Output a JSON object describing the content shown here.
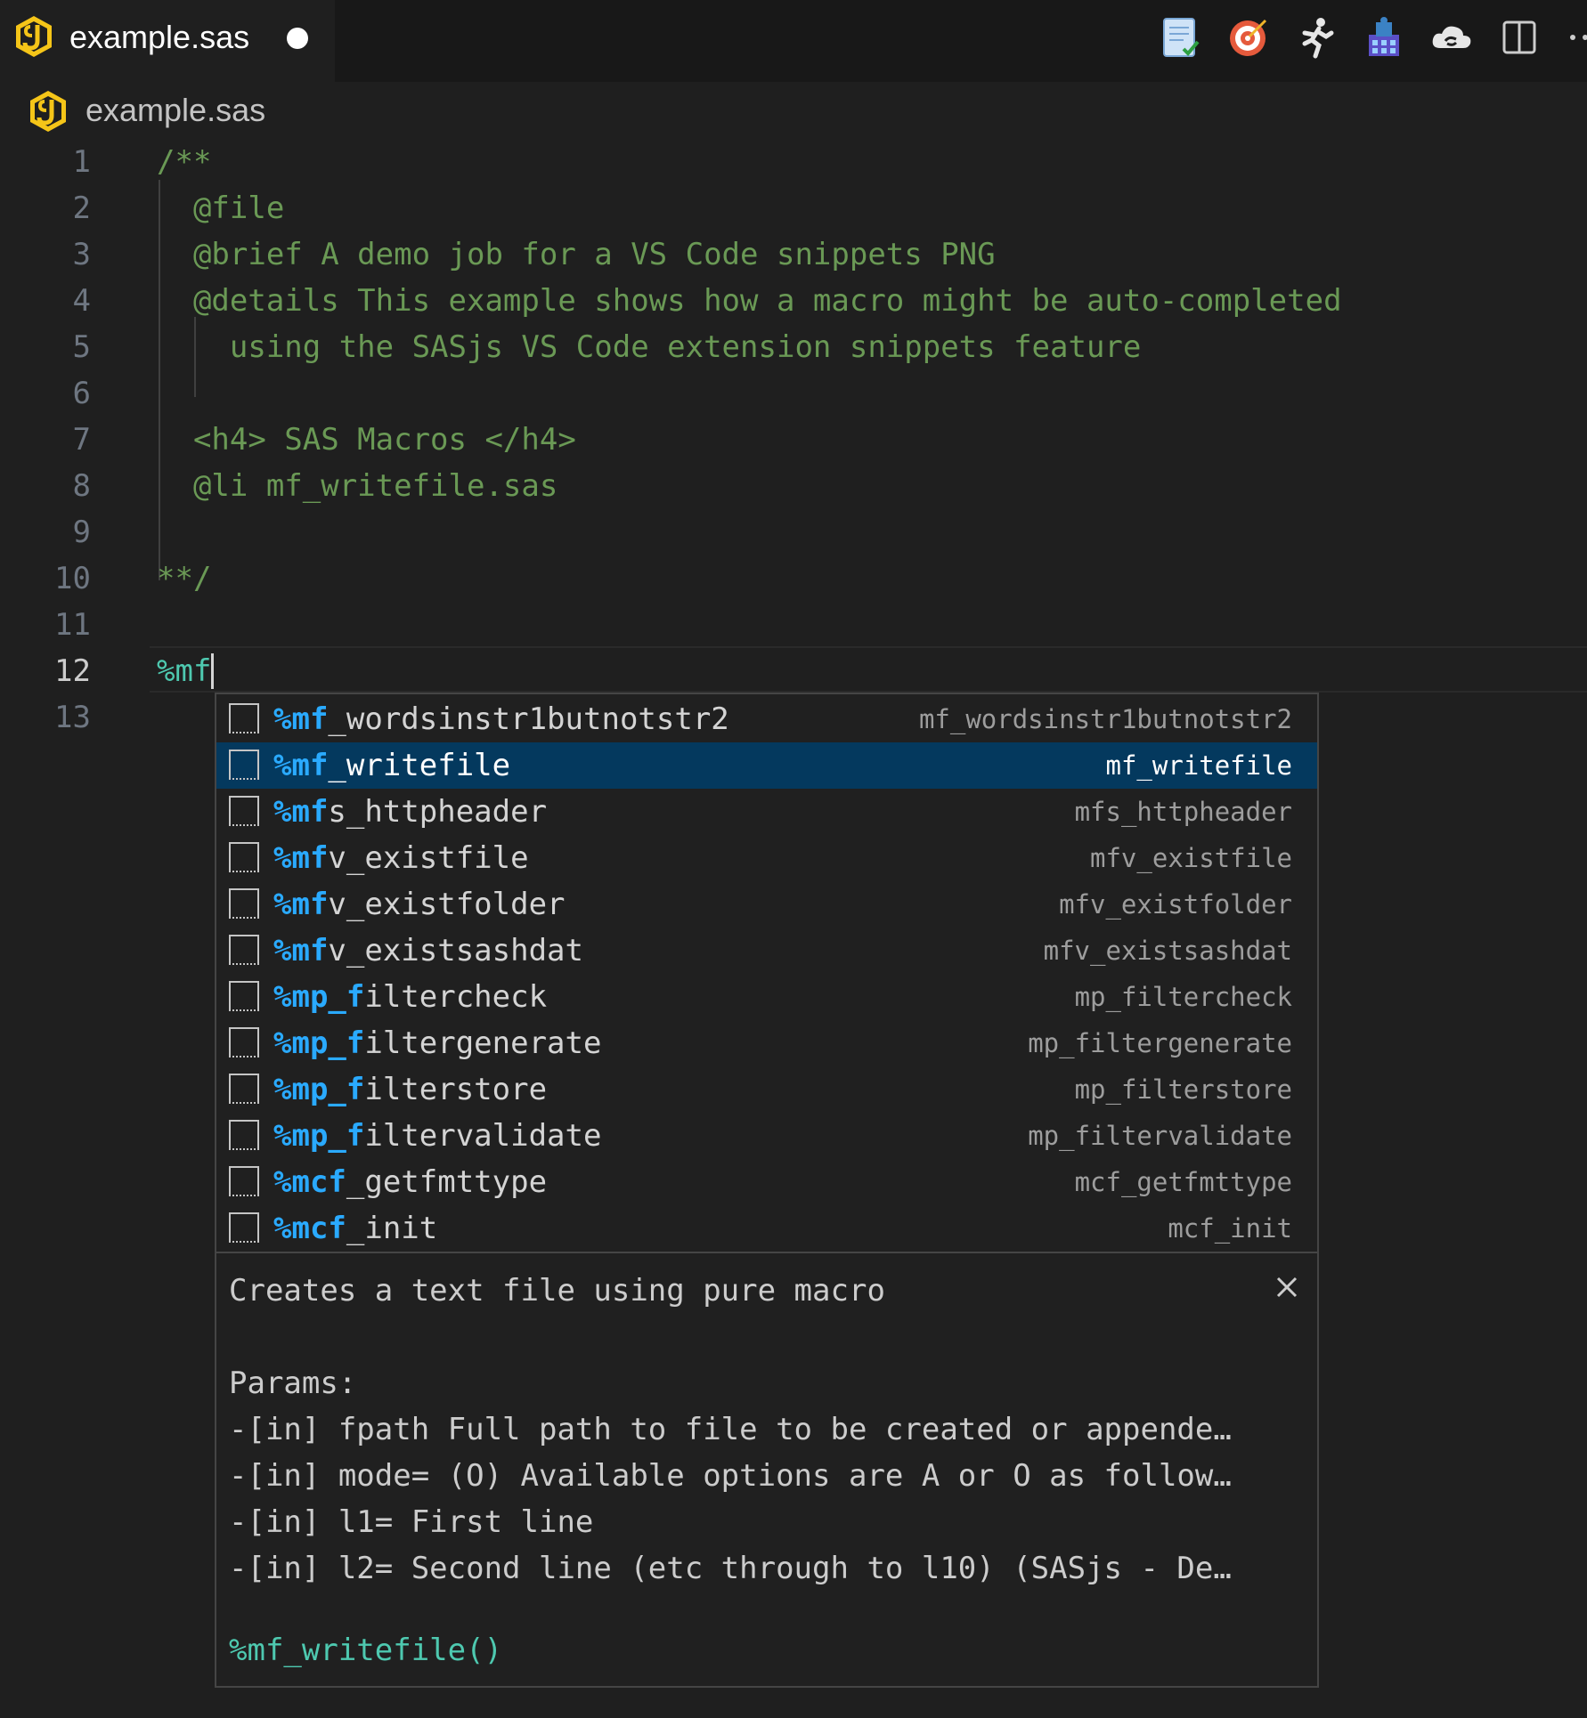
{
  "tab": {
    "title": "example.sas"
  },
  "breadcrumb": {
    "file": "example.sas"
  },
  "toolbar": {
    "actions": [
      "notes-check-icon",
      "target-icon",
      "running-man-icon",
      "building-icon",
      "cloud-sync-icon",
      "split-editor-icon",
      "more-actions-icon"
    ]
  },
  "editor": {
    "lines": [
      {
        "number": "1",
        "text": "/**"
      },
      {
        "number": "2",
        "text": "  @file"
      },
      {
        "number": "3",
        "text": "  @brief A demo job for a VS Code snippets PNG"
      },
      {
        "number": "4",
        "text": "  @details This example shows how a macro might be auto-completed"
      },
      {
        "number": "5",
        "text": "    using the SASjs VS Code extension snippets feature"
      },
      {
        "number": "6",
        "text": ""
      },
      {
        "number": "7",
        "text": "  <h4> SAS Macros </h4>"
      },
      {
        "number": "8",
        "text": "  @li mf_writefile.sas"
      },
      {
        "number": "9",
        "text": ""
      },
      {
        "number": "10",
        "text": "**/"
      },
      {
        "number": "11",
        "text": ""
      },
      {
        "number": "12",
        "text": "%mf"
      },
      {
        "number": "13",
        "text": ""
      }
    ],
    "active_line": "12"
  },
  "suggestions": {
    "items": [
      {
        "prefix": "%mf",
        "rest": "_wordsinstr1butnotstr2",
        "detail": "mf_wordsinstr1butnotstr2",
        "selected": false
      },
      {
        "prefix": "%mf",
        "rest": "_writefile",
        "detail": "mf_writefile",
        "selected": true
      },
      {
        "prefix": "%mf",
        "rest": "s_httpheader",
        "detail": "mfs_httpheader",
        "selected": false
      },
      {
        "prefix": "%mf",
        "rest": "v_existfile",
        "detail": "mfv_existfile",
        "selected": false
      },
      {
        "prefix": "%mf",
        "rest": "v_existfolder",
        "detail": "mfv_existfolder",
        "selected": false
      },
      {
        "prefix": "%mf",
        "rest": "v_existsashdat",
        "detail": "mfv_existsashdat",
        "selected": false
      },
      {
        "prefix": "%mp_f",
        "rest": "iltercheck",
        "detail": "mp_filtercheck",
        "selected": false
      },
      {
        "prefix": "%mp_f",
        "rest": "iltergenerate",
        "detail": "mp_filtergenerate",
        "selected": false
      },
      {
        "prefix": "%mp_f",
        "rest": "ilterstore",
        "detail": "mp_filterstore",
        "selected": false
      },
      {
        "prefix": "%mp_f",
        "rest": "iltervalidate",
        "detail": "mp_filtervalidate",
        "selected": false
      },
      {
        "prefix": "%mcf",
        "rest": "_getfmttype",
        "detail": "mcf_getfmttype",
        "selected": false
      },
      {
        "prefix": "%mcf",
        "rest": "_init",
        "detail": "mcf_init",
        "selected": false
      }
    ]
  },
  "details": {
    "description": "Creates a text file using pure macro",
    "params_heading": "Params:",
    "params": [
      "-[in] fpath Full path to file to be created or appende…",
      "-[in] mode= (O) Available options are A or O as follow…",
      "-[in] l1= First line",
      "-[in] l2= Second line (etc through to l10) (SASjs - De…"
    ],
    "signature": "%mf_writefile()"
  }
}
